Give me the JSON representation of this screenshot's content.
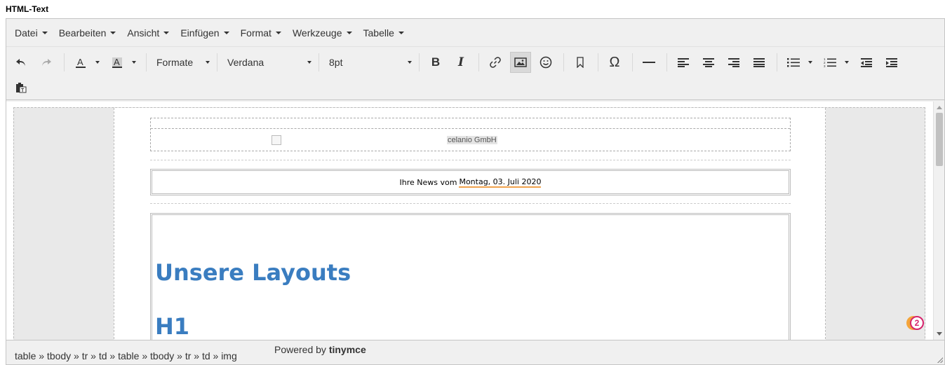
{
  "field_label": "HTML-Text",
  "menubar": {
    "items": [
      "Datei",
      "Bearbeiten",
      "Ansicht",
      "Einfügen",
      "Format",
      "Werkzeuge",
      "Tabelle"
    ]
  },
  "toolbar": {
    "formats_label": "Formate",
    "font_family": "Verdana",
    "font_size": "8pt",
    "bold_label": "B",
    "italic_label": "I",
    "special_char_label": "Ω"
  },
  "content": {
    "logo_alt": "celanio GmbH",
    "news_prefix": "Ihre News vom",
    "news_date": "Montag, 03. Juli 2020",
    "heading_layouts": "Unsere Layouts",
    "heading_h1": "H1"
  },
  "badge": {
    "count": "2"
  },
  "statusbar": {
    "path": "table » tbody » tr » td » table » tbody » tr » td » img",
    "powered_prefix": "Powered by",
    "powered_brand": "tinymce"
  }
}
